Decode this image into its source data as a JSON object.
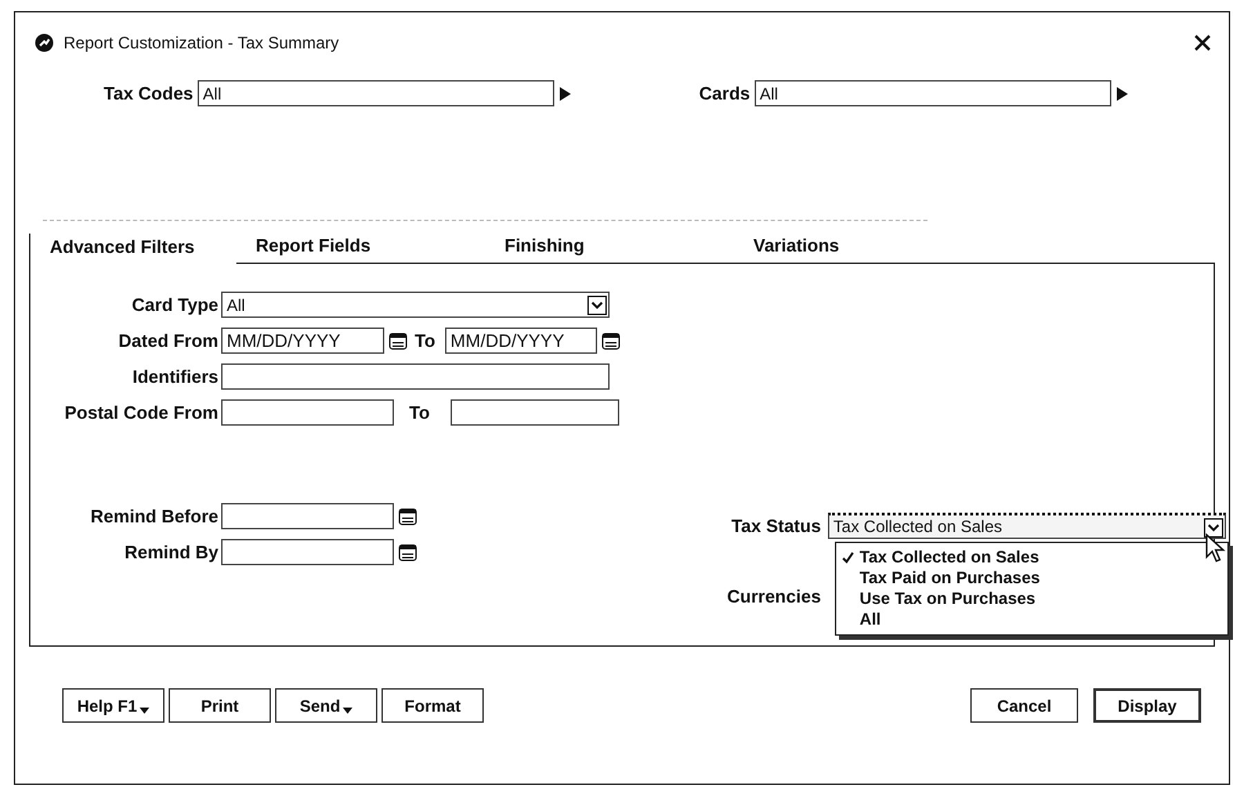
{
  "window": {
    "title": "Report Customization - Tax Summary"
  },
  "selectors": [
    {
      "label": "Tax Codes",
      "value": "All"
    },
    {
      "label": "Cards",
      "value": "All"
    }
  ],
  "tabs": [
    {
      "label": "Advanced Filters",
      "selected": true
    },
    {
      "label": "Report Fields",
      "selected": false
    },
    {
      "label": "Finishing",
      "selected": false
    },
    {
      "label": "Variations",
      "selected": false
    }
  ],
  "filters": [
    {
      "kind": "select",
      "label": "Card Type",
      "value": "All"
    },
    {
      "kind": "date_range",
      "label": "Dated From",
      "placeholder": "MM/DD/YYYY",
      "to_label": "To",
      "to_placeholder": "MM/DD/YYYY"
    },
    {
      "kind": "text",
      "label": "Identifiers"
    },
    {
      "kind": "range",
      "label": "Postal Code From",
      "to_label": "To"
    }
  ],
  "reminders": [
    {
      "label": "Remind Before"
    },
    {
      "label": "Remind By"
    }
  ],
  "tax_status": {
    "label": "Tax Status",
    "value": "Tax Collected on Sales",
    "expanded": true,
    "options": [
      {
        "label": "Tax Collected on Sales",
        "selected": true
      },
      {
        "label": "Tax Paid on Purchases",
        "selected": false
      },
      {
        "label": "Use Tax on Purchases",
        "selected": false
      },
      {
        "label": "All",
        "selected": false
      }
    ]
  },
  "currencies": {
    "label": "Currencies"
  },
  "left_buttons": [
    {
      "label": "Help F1",
      "menu": true
    },
    {
      "label": "Print",
      "menu": false
    },
    {
      "label": "Send",
      "menu": true
    },
    {
      "label": "Format",
      "menu": false
    }
  ],
  "right_buttons": [
    {
      "label": "Cancel",
      "default": false
    },
    {
      "label": "Display",
      "default": true
    }
  ]
}
